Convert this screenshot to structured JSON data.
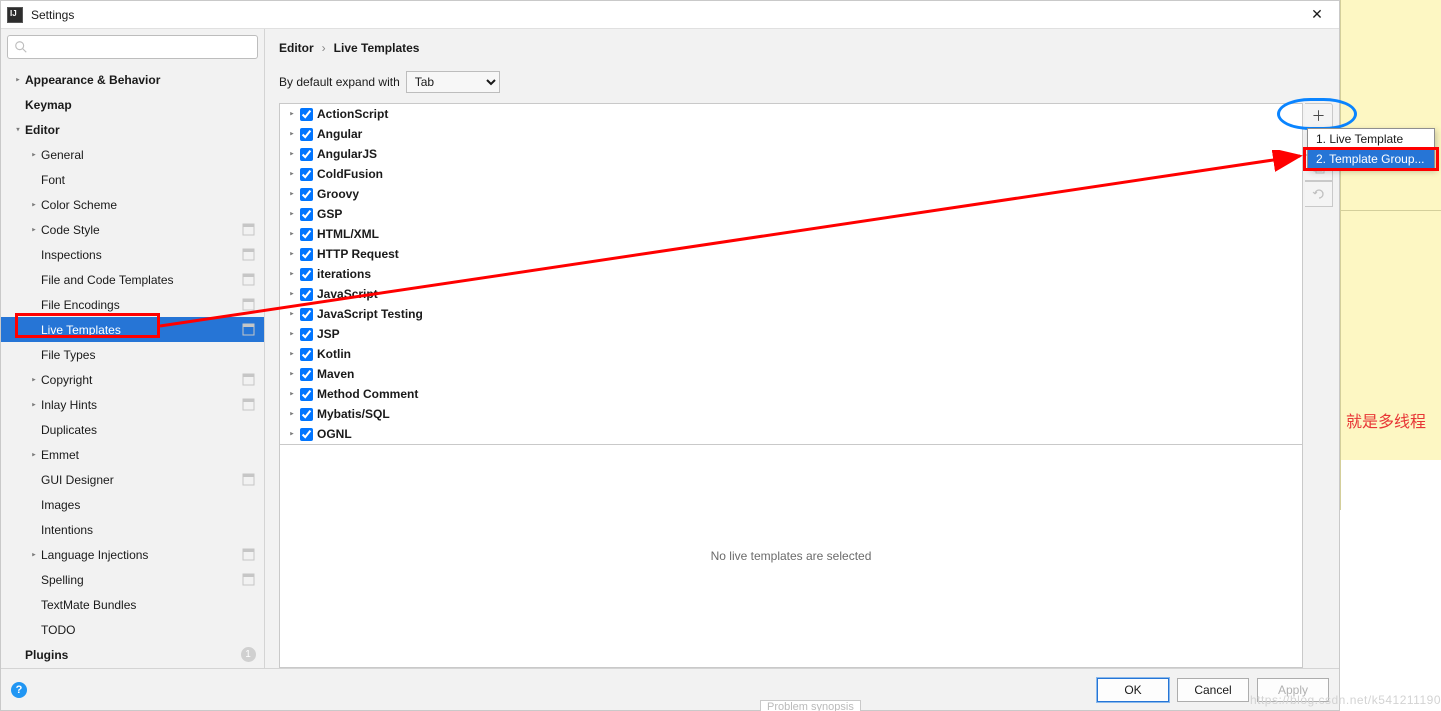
{
  "title": "Settings",
  "search_placeholder": "",
  "sidebar": [
    {
      "label": "Appearance & Behavior",
      "depth": 0,
      "expand": ">",
      "bold": true
    },
    {
      "label": "Keymap",
      "depth": 0,
      "expand": "",
      "bold": true
    },
    {
      "label": "Editor",
      "depth": 0,
      "expand": "v",
      "bold": true
    },
    {
      "label": "General",
      "depth": 1,
      "expand": ">"
    },
    {
      "label": "Font",
      "depth": 1,
      "expand": ""
    },
    {
      "label": "Color Scheme",
      "depth": 1,
      "expand": ">"
    },
    {
      "label": "Code Style",
      "depth": 1,
      "expand": ">",
      "badge": true
    },
    {
      "label": "Inspections",
      "depth": 1,
      "expand": "",
      "badge": true
    },
    {
      "label": "File and Code Templates",
      "depth": 1,
      "expand": "",
      "badge": true
    },
    {
      "label": "File Encodings",
      "depth": 1,
      "expand": "",
      "badge": true
    },
    {
      "label": "Live Templates",
      "depth": 1,
      "expand": "",
      "selected": true,
      "badge": true
    },
    {
      "label": "File Types",
      "depth": 1,
      "expand": ""
    },
    {
      "label": "Copyright",
      "depth": 1,
      "expand": ">",
      "badge": true
    },
    {
      "label": "Inlay Hints",
      "depth": 1,
      "expand": ">",
      "badge": true
    },
    {
      "label": "Duplicates",
      "depth": 1,
      "expand": ""
    },
    {
      "label": "Emmet",
      "depth": 1,
      "expand": ">"
    },
    {
      "label": "GUI Designer",
      "depth": 1,
      "expand": "",
      "badge": true
    },
    {
      "label": "Images",
      "depth": 1,
      "expand": ""
    },
    {
      "label": "Intentions",
      "depth": 1,
      "expand": ""
    },
    {
      "label": "Language Injections",
      "depth": 1,
      "expand": ">",
      "badge": true
    },
    {
      "label": "Spelling",
      "depth": 1,
      "expand": "",
      "badge": true
    },
    {
      "label": "TextMate Bundles",
      "depth": 1,
      "expand": ""
    },
    {
      "label": "TODO",
      "depth": 1,
      "expand": ""
    },
    {
      "label": "Plugins",
      "depth": 0,
      "expand": "",
      "bold": true,
      "count": true
    }
  ],
  "breadcrumb": {
    "a": "Editor",
    "b": "Live Templates"
  },
  "expand_label": "By default expand with",
  "expand_value": "Tab",
  "groups": [
    "ActionScript",
    "Angular",
    "AngularJS",
    "ColdFusion",
    "Groovy",
    "GSP",
    "HTML/XML",
    "HTTP Request",
    "iterations",
    "JavaScript",
    "JavaScript Testing",
    "JSP",
    "Kotlin",
    "Maven",
    "Method Comment",
    "Mybatis/SQL",
    "OGNL"
  ],
  "empty_text": "No live templates are selected",
  "popup": {
    "item1": "1. Live Template",
    "item2": "2. Template Group..."
  },
  "footer": {
    "ok": "OK",
    "cancel": "Cancel",
    "apply": "Apply"
  },
  "red_text": "就是多线程",
  "watermark": "https://blog.csdn.net/k541211190",
  "bottom_frag": "Problem synopsis"
}
